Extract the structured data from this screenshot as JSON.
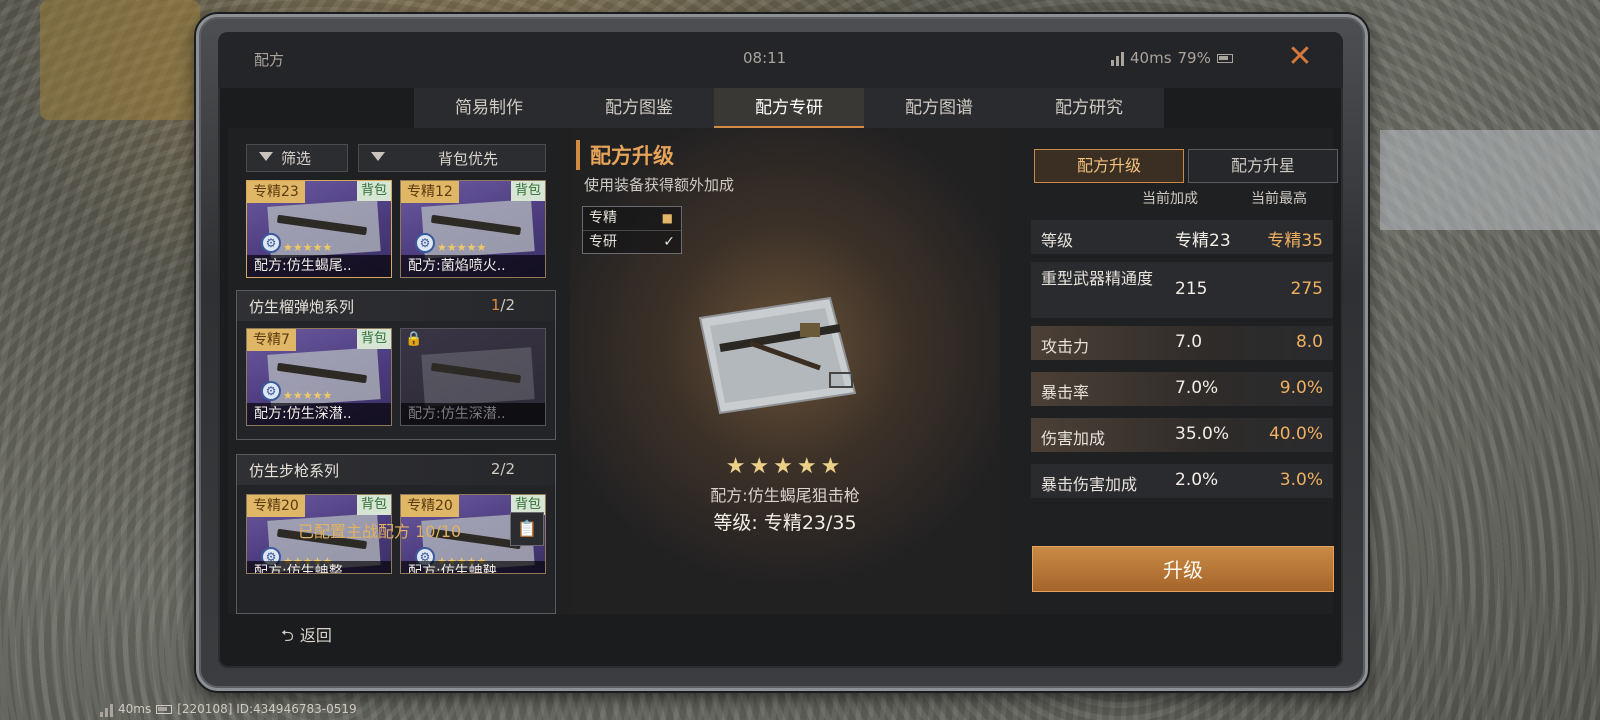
{
  "window": {
    "title": "配方",
    "clock": "08:11",
    "ping": "40ms",
    "battery": "79%"
  },
  "tabs": [
    {
      "label": "简易制作"
    },
    {
      "label": "配方图鉴"
    },
    {
      "label": "配方专研",
      "active": true
    },
    {
      "label": "配方图谱"
    },
    {
      "label": "配方研究"
    }
  ],
  "filters": {
    "filter_label": "筛选",
    "sort_label": "背包优先"
  },
  "cards_top": [
    {
      "spec": "专精23",
      "bag": "背包",
      "stars": "★★★★★",
      "name": "配方:仿生蝎尾.."
    },
    {
      "spec": "专精12",
      "bag": "背包",
      "stars": "★★★★★",
      "name": "配方:菌焰喷火.."
    }
  ],
  "groups": [
    {
      "title": "仿生榴弹炮系列",
      "count_cur": "1",
      "count_total": "/2",
      "cards": [
        {
          "spec": "专精7",
          "bag": "背包",
          "stars": "★★★★★",
          "name": "配方:仿生深潜.."
        },
        {
          "name": "配方:仿生深潜.."
        }
      ]
    },
    {
      "title": "仿生步枪系列",
      "count_cur": "2",
      "count_total": "/2",
      "cards": [
        {
          "spec": "专精20",
          "bag": "背包",
          "stars": "★★★★★",
          "name": "配方:仿生蚺整"
        },
        {
          "spec": "专精20",
          "bag": "背包",
          "stars": "★★★★★",
          "name": "配方:仿生蚺鞅"
        }
      ]
    }
  ],
  "configured": "已配置主战配方 10/10",
  "center": {
    "title": "配方升级",
    "subtitle": "使用装备获得额外加成",
    "legend": [
      {
        "label": "专精"
      },
      {
        "label": "专研"
      }
    ],
    "stars": "★★★★★",
    "item_name": "配方:仿生蝎尾狙击枪",
    "level_label": "等级:",
    "level_value": "专精23/35"
  },
  "right": {
    "subtabs": [
      {
        "label": "配方升级",
        "active": true
      },
      {
        "label": "配方升星"
      }
    ],
    "col_current": "当前加成",
    "col_max": "当前最高",
    "stats": [
      {
        "name": "等级",
        "current": "专精23",
        "max": "专精35"
      },
      {
        "name": "重型武器精通度",
        "current": "215",
        "max": "275"
      },
      {
        "name": "攻击力",
        "current": "7.0",
        "max": "8.0"
      },
      {
        "name": "暴击率",
        "current": "7.0%",
        "max": "9.0%"
      },
      {
        "name": "伤害加成",
        "current": "35.0%",
        "max": "40.0%"
      },
      {
        "name": "暴击伤害加成",
        "current": "2.0%",
        "max": "3.0%"
      }
    ],
    "upgrade_label": "升级"
  },
  "back_label": "返回",
  "footer": {
    "ping": "40ms",
    "id_text": "[220108] ID:434946783-0519"
  },
  "colors": {
    "accent": "#d08b45",
    "purple_card": "#4a3a7c",
    "bag_badge": "#d7e6d4"
  }
}
